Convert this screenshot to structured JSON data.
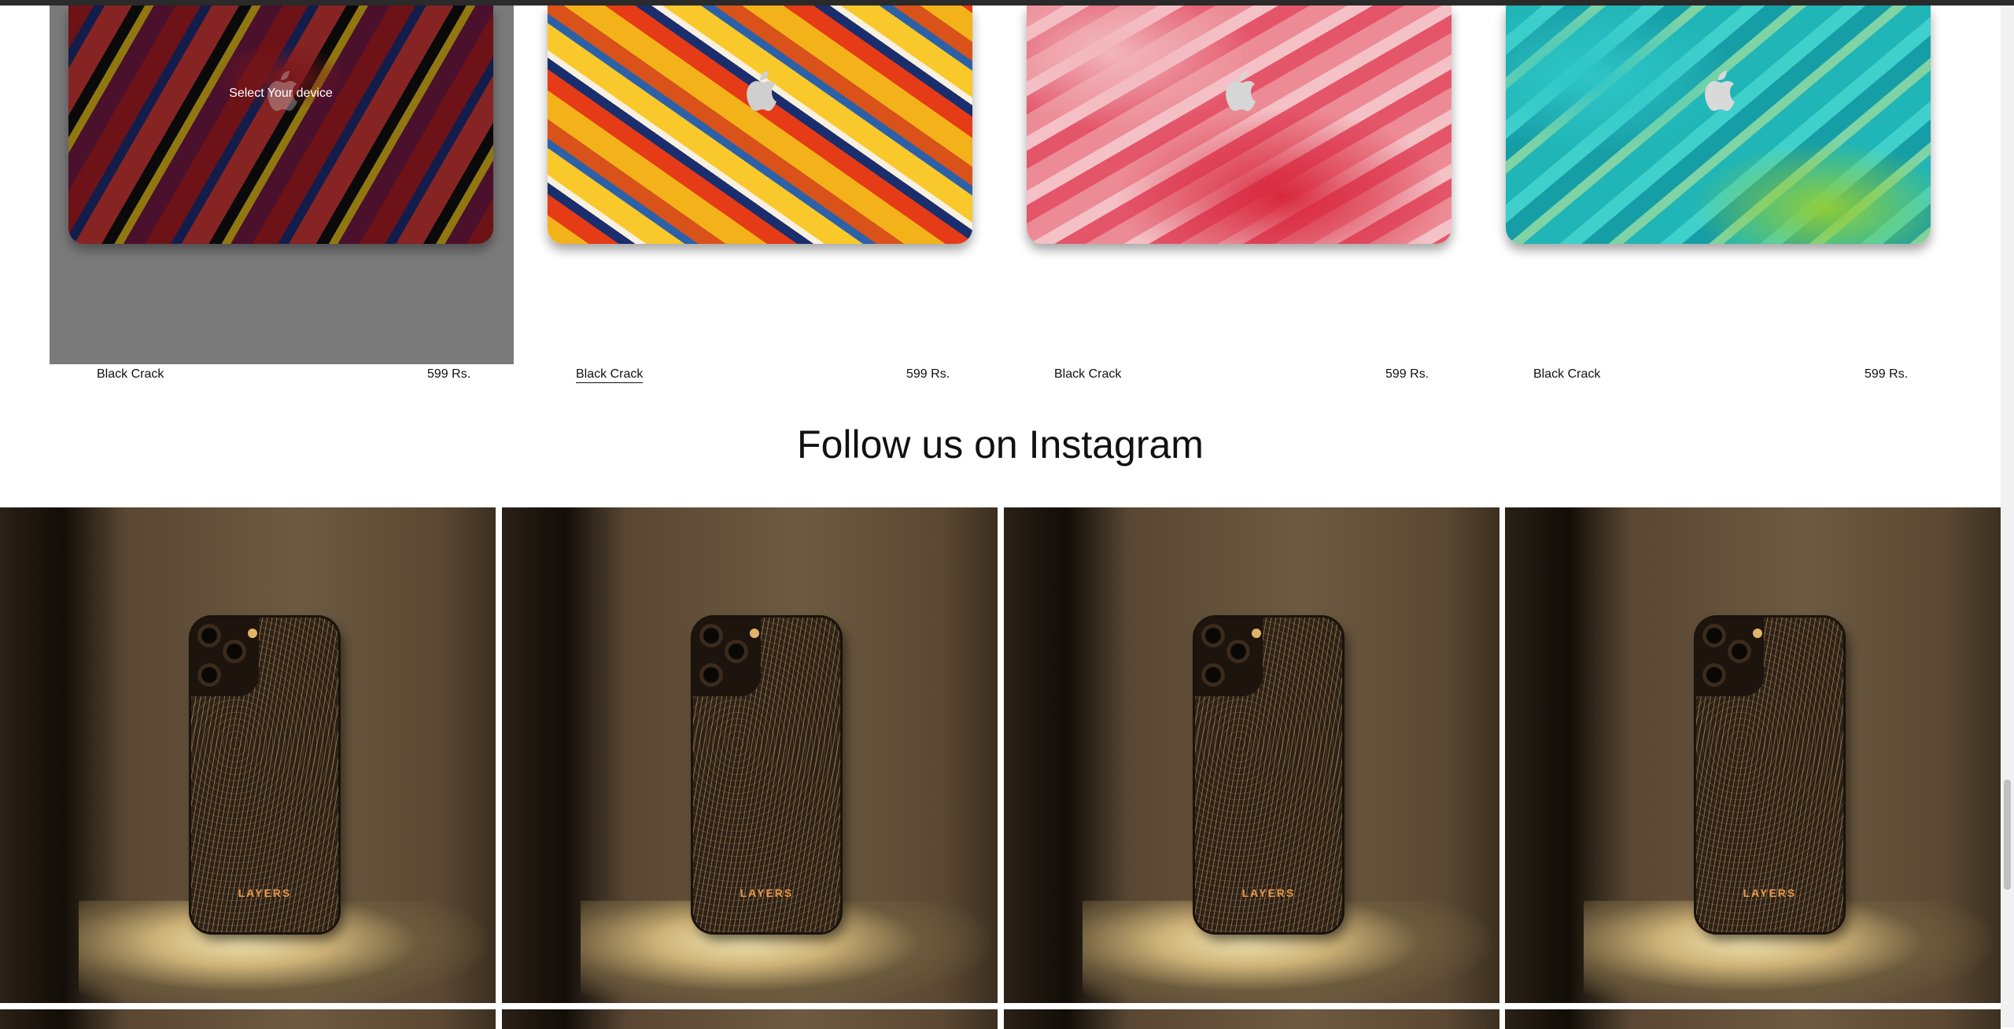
{
  "products": [
    {
      "name": "Black Crack",
      "price": "599 Rs.",
      "overlay_text": "Select Your device",
      "state": "hovered"
    },
    {
      "name": "Black Crack",
      "price": "599 Rs.",
      "state": "name-underlined"
    },
    {
      "name": "Black Crack",
      "price": "599 Rs."
    },
    {
      "name": "Black Crack",
      "price": "599 Rs."
    }
  ],
  "instagram": {
    "title": "Follow us on Instagram",
    "brand_text": "LAYERS"
  },
  "colors": {
    "overlay": "#7a7a7a",
    "brand_orange": "#e8994a"
  }
}
